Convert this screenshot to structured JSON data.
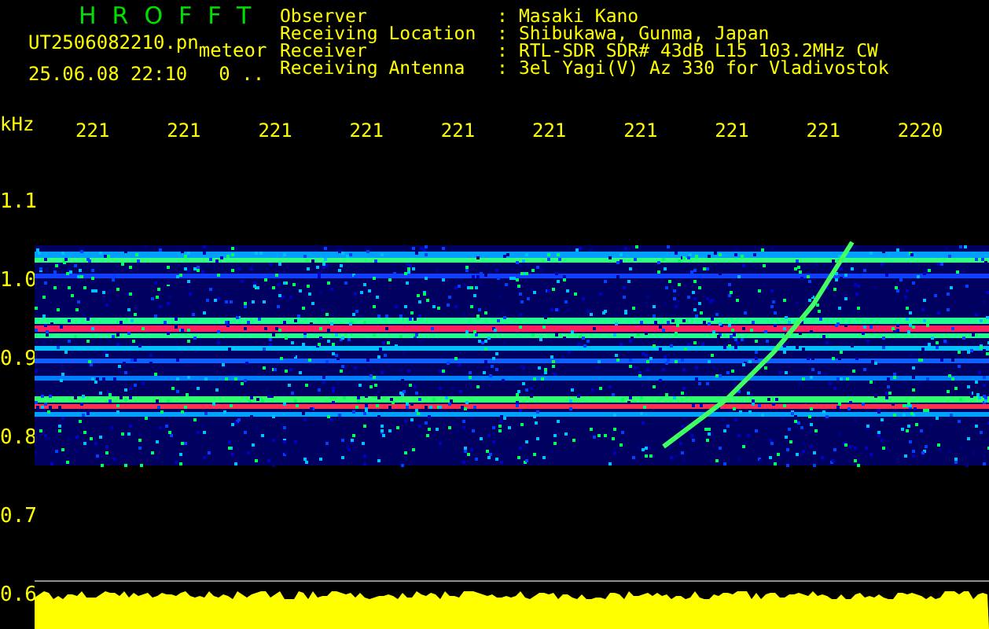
{
  "app": {
    "title": "HROFFT"
  },
  "file": {
    "name": "UT2506082210.pn",
    "tag": "meteor",
    "datetime": "25.06.08 22:10",
    "value": "0 .."
  },
  "info": [
    {
      "label": "Observer",
      "separator": ":",
      "value": "Masaki Kano"
    },
    {
      "label": "Receiving Location",
      "separator": ":",
      "value": "Shibukawa, Gunma, Japan"
    },
    {
      "label": "Receiver",
      "separator": ":",
      "value": "RTL-SDR SDR# 43dB L15 103.2MHz CW"
    },
    {
      "label": "Receiving Antenna",
      "separator": ":",
      "value": "3el Yagi(V) Az 330 for Vladivostok"
    }
  ],
  "axis": {
    "unit": "kHz",
    "time_labels": [
      "221",
      "221",
      "221",
      "221",
      "221",
      "221",
      "221",
      "221",
      "221",
      "2220"
    ],
    "freq_labels": [
      "1.1",
      "1.0",
      "0.9",
      "0.8",
      "0.7",
      "0.6"
    ]
  }
}
